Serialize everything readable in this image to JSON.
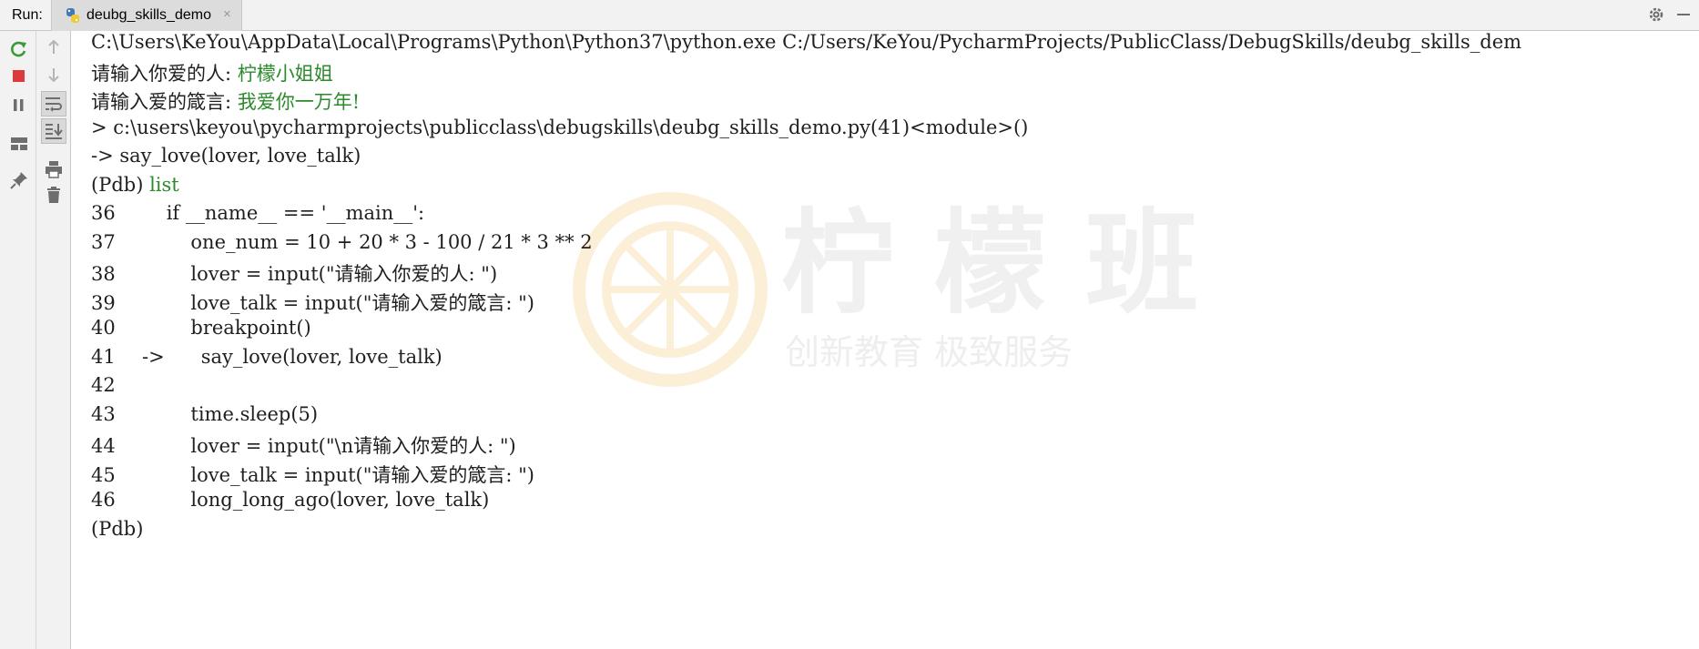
{
  "topbar": {
    "run_label": "Run:",
    "tab_label": "deubg_skills_demo",
    "tab_close": "×"
  },
  "watermark": {
    "brand": "柠 檬 班",
    "slogan": "创新教育  极致服务"
  },
  "console": {
    "cmd": "C:\\Users\\KeYou\\AppData\\Local\\Programs\\Python\\Python37\\python.exe C:/Users/KeYou/PycharmProjects/PublicClass/DebugSkills/deubg_skills_dem",
    "prompt1": "请输入你爱的人: ",
    "answer1": "柠檬小姐姐",
    "prompt2": "请输入爱的箴言: ",
    "answer2": "我爱你一万年!",
    "location": "> c:\\users\\keyou\\pycharmprojects\\publicclass\\debugskills\\deubg_skills_demo.py(41)<module>()",
    "current": "-> say_love(lover, love_talk)",
    "pdb_prompt": "(Pdb) ",
    "pdb_command": "list",
    "code": [
      {
        "num": "36",
        "marker": "",
        "text": "    if __name__ == '__main__':"
      },
      {
        "num": "37",
        "marker": "",
        "text": "        one_num = 10 + 20 * 3 - 100 / 21 * 3 ** 2"
      },
      {
        "num": "38",
        "marker": "",
        "text": "        lover = input(\"请输入你爱的人: \")"
      },
      {
        "num": "39",
        "marker": "",
        "text": "        love_talk = input(\"请输入爱的箴言: \")"
      },
      {
        "num": "40",
        "marker": "",
        "text": "        breakpoint()"
      },
      {
        "num": "41",
        "marker": "->",
        "text": "      say_love(lover, love_talk)"
      },
      {
        "num": "42",
        "marker": "",
        "text": ""
      },
      {
        "num": "43",
        "marker": "",
        "text": "        time.sleep(5)"
      },
      {
        "num": "44",
        "marker": "",
        "text": "        lover = input(\"\\n请输入你爱的人: \")"
      },
      {
        "num": "45",
        "marker": "",
        "text": "        love_talk = input(\"请输入爱的箴言: \")"
      },
      {
        "num": "46",
        "marker": "",
        "text": "        long_long_ago(lover, love_talk)"
      }
    ],
    "final_prompt": "(Pdb)"
  },
  "colors": {
    "input_green": "#2b8a2b",
    "rerun_green": "#3a9a3a",
    "stop_red": "#db3b3b",
    "icon_gray": "#6e6e6e"
  },
  "icons": {
    "rerun": "rerun-icon",
    "stop": "stop-icon",
    "pause": "pause-icon",
    "layout": "layout-icon",
    "pin": "pin-icon",
    "up": "arrow-up-icon",
    "down": "arrow-down-icon",
    "wrap": "soft-wrap-icon",
    "scroll": "scroll-to-end-icon",
    "print": "print-icon",
    "trash": "trash-icon",
    "gear": "gear-icon",
    "minimize": "minimize-icon"
  }
}
